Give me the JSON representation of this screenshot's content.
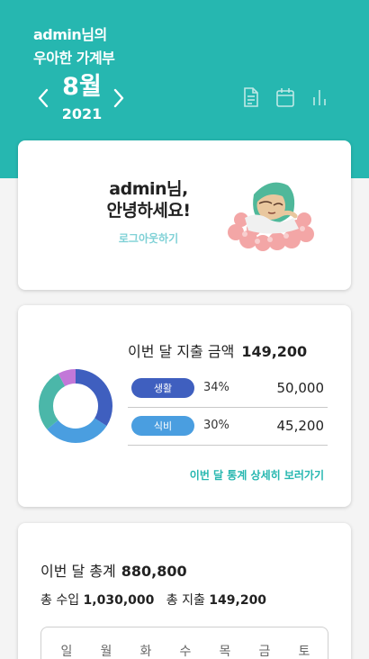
{
  "header": {
    "title_line1": "admin님의",
    "title_line2": "우아한 가계부",
    "month": "8월",
    "year": "2021",
    "icons": [
      "document-icon",
      "calendar-icon",
      "chart-icon"
    ]
  },
  "greeting": {
    "line1": "admin님,",
    "line2": "안녕하세요!",
    "logout_label": "로그아웃하기"
  },
  "spending": {
    "title": "이번 달 지출 금액",
    "total": "149,200",
    "categories": [
      {
        "name": "생활",
        "percent": "34%",
        "amount": "50,000",
        "color": "#3f5fbf"
      },
      {
        "name": "식비",
        "percent": "30%",
        "amount": "45,200",
        "color": "#4a9ee0"
      }
    ],
    "detail_link": "이번 달 통계 상세히 보러가기"
  },
  "chart_data": {
    "type": "pie",
    "values": [
      34,
      30,
      28,
      8
    ],
    "colors": [
      "#3f5fbf",
      "#4a9ee0",
      "#4bb7a9",
      "#c278d8"
    ]
  },
  "totals": {
    "label": "이번 달 총계",
    "amount": "880,800",
    "income_label": "총 수입",
    "income": "1,030,000",
    "expense_label": "총 지출",
    "expense": "149,200"
  },
  "calendar": {
    "weekdays": [
      "일",
      "월",
      "화",
      "수",
      "목",
      "금",
      "토"
    ]
  },
  "colors": {
    "accent": "#26b7b0",
    "logout": "#7fd1d6"
  }
}
